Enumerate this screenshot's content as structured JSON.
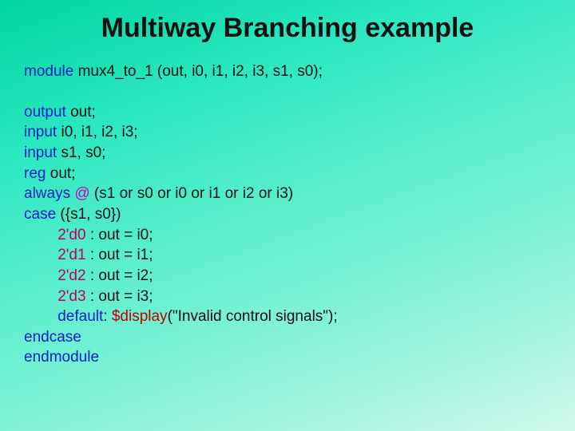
{
  "title": "Multiway Branching example",
  "kw": {
    "module": "module",
    "output": "output",
    "input": "input",
    "reg": "reg",
    "always": "always",
    "case": "case",
    "default": "default",
    "endcase": "endcase",
    "endmodule": "endmodule"
  },
  "op": {
    "at": "@"
  },
  "lit": {
    "d0": "2'd0",
    "d1": "2'd1",
    "d2": "2'd2",
    "d3": "2'd3"
  },
  "sys": {
    "display": "$display"
  },
  "txt": {
    "mod_decl": " mux4_to_1 (out, i0, i1, i2, i3, s1, s0);",
    "out_decl": " out;",
    "in_i": " i0, i1, i2, i3;",
    "in_s": " s1, s0;",
    "reg_out": " out;",
    "always_pre": " ",
    "sens": " (s1 or s0 or i0 or i1 or i2 or i3)",
    "case_cond": " ({s1, s0})",
    "c0": " : out = i0;",
    "c1": " : out = i1;",
    "c2": " : out = i2;",
    "c3": " : out = i3;",
    "def_colon": ": ",
    "disp_arg": "(\"Invalid control signals\");"
  }
}
